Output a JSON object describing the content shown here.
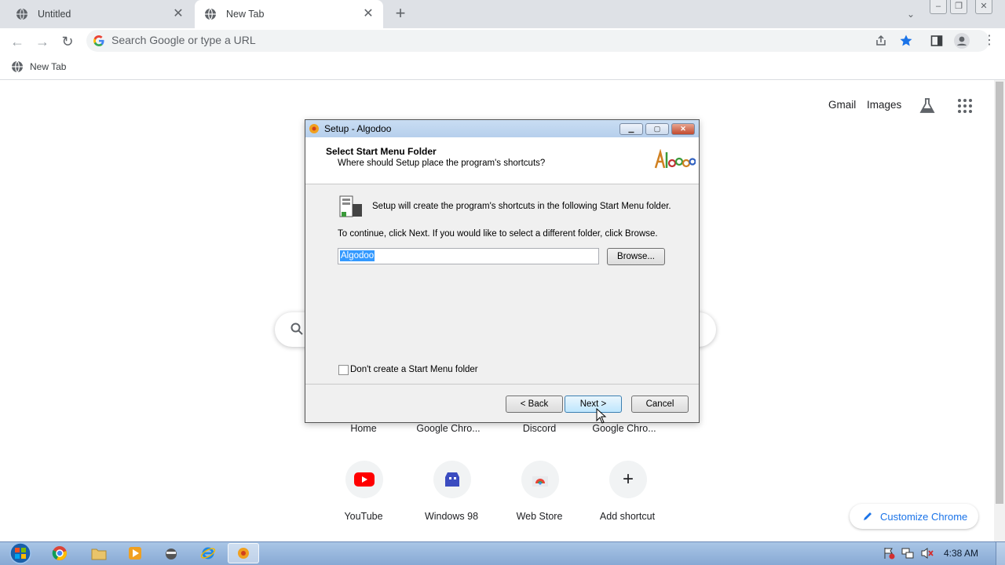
{
  "browser": {
    "tabs": [
      {
        "title": "Untitled",
        "active": false
      },
      {
        "title": "New Tab",
        "active": true
      }
    ],
    "omnibox_placeholder": "Search Google or type a URL",
    "bookmark_bar": [
      {
        "label": "New Tab"
      }
    ]
  },
  "ntp": {
    "header_links": [
      "Gmail",
      "Images"
    ],
    "shortcut_row1": [
      "Home",
      "Google Chro...",
      "Discord",
      "Google Chro..."
    ],
    "shortcut_row2": [
      "YouTube",
      "Windows 98",
      "Web Store",
      "Add shortcut"
    ],
    "customize_label": "Customize Chrome"
  },
  "dialog": {
    "window_title": "Setup - Algodoo",
    "heading": "Select Start Menu Folder",
    "subheading": "Where should Setup place the program's shortcuts?",
    "info_text": "Setup will create the program's shortcuts in the following Start Menu folder.",
    "instruction_text": "To continue, click Next. If you would like to select a different folder, click Browse.",
    "folder_value": "Algodoo",
    "browse_label": "Browse...",
    "checkbox_label": "Don't create a Start Menu folder",
    "checkbox_checked": false,
    "back_label": "< Back",
    "next_label": "Next >",
    "cancel_label": "Cancel"
  },
  "taskbar": {
    "clock": "4:38 AM"
  },
  "colors": {
    "accent_blue": "#1a73e8",
    "selection": "#3399ff",
    "youtube_red": "#ff0000"
  }
}
